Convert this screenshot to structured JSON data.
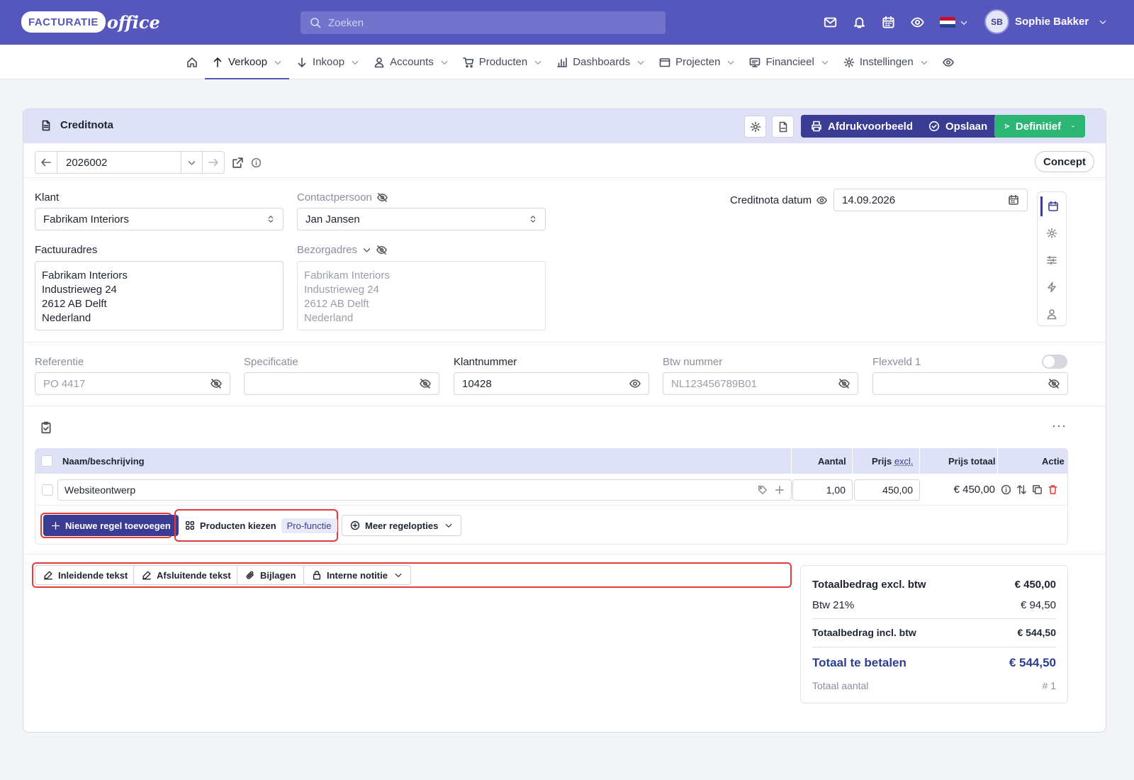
{
  "app": {
    "logo_word1": "FACTURATIE",
    "logo_word2": "office"
  },
  "search": {
    "placeholder": "Zoeken"
  },
  "user": {
    "initials": "SB",
    "name": "Sophie Bakker"
  },
  "nav": [
    {
      "label": "Verkoop",
      "icon": "arrow-up-icon"
    },
    {
      "label": "Inkoop",
      "icon": "arrow-down-icon"
    },
    {
      "label": "Accounts",
      "icon": "person-icon"
    },
    {
      "label": "Producten",
      "icon": "cart-icon"
    },
    {
      "label": "Dashboards",
      "icon": "bar-chart-icon"
    },
    {
      "label": "Projecten",
      "icon": "folder-icon"
    },
    {
      "label": "Financieel",
      "icon": "monitor-icon"
    },
    {
      "label": "Instellingen",
      "icon": "gear-icon"
    }
  ],
  "doc": {
    "title": "Creditnota",
    "print_preview": "Afdrukvoorbeeld",
    "save": "Opslaan",
    "final": "Definitief",
    "number": "2026002",
    "status": "Concept"
  },
  "form": {
    "klant_label": "Klant",
    "klant_value": "Fabrikam Interiors",
    "contact_label": "Contactpersoon",
    "contact_value": "Jan Jansen",
    "date_label": "Creditnota datum",
    "date_value": "14.09.2026",
    "factuuradres_label": "Factuuradres",
    "factuuradres_lines": [
      "Fabrikam Interiors",
      "Industrieweg 24",
      "2612 AB Delft",
      "Nederland"
    ],
    "bezorgadres_label": "Bezorgadres",
    "bezorgadres_lines": [
      "Fabrikam Interiors",
      "Industrieweg 24",
      "2612 AB Delft",
      "Nederland"
    ],
    "referentie_label": "Referentie",
    "referentie_placeholder": "PO 4417",
    "specificatie_label": "Specificatie",
    "klantnummer_label": "Klantnummer",
    "klantnummer_value": "10428",
    "btw_label": "Btw nummer",
    "btw_placeholder": "NL123456789B01",
    "flexveld_label": "Flexveld 1"
  },
  "table": {
    "col_name": "Naam/beschrijving",
    "col_qty": "Aantal",
    "col_price": "Prijs",
    "col_price_suffix": "excl.",
    "col_total": "Prijs totaal",
    "col_action": "Actie",
    "rows": [
      {
        "name": "Websiteontwerp",
        "qty": "1,00",
        "price": "450,00",
        "total": "€ 450,00"
      }
    ],
    "add_line": "Nieuwe regel toevoegen",
    "choose_products": "Producten kiezen",
    "pro_badge": "Pro-functie",
    "more_options": "Meer regelopties"
  },
  "footer_buttons": {
    "intro": "Inleidende tekst",
    "closing": "Afsluitende tekst",
    "attachments": "Bijlagen",
    "note": "Interne notitie"
  },
  "totals": {
    "excl_label": "Totaalbedrag excl. btw",
    "excl_value": "€ 450,00",
    "vat_label": "Btw 21%",
    "vat_value": "€ 94,50",
    "incl_label": "Totaalbedrag incl. btw",
    "incl_value": "€ 544,50",
    "pay_label": "Totaal te betalen",
    "pay_value": "€ 544,50",
    "count_label": "Totaal aantal",
    "count_value": "# 1"
  },
  "colors": {
    "brand": "#5557bd",
    "dark_button": "#3a3c93",
    "green_button": "#2bb673",
    "highlight": "#e23b3b"
  }
}
